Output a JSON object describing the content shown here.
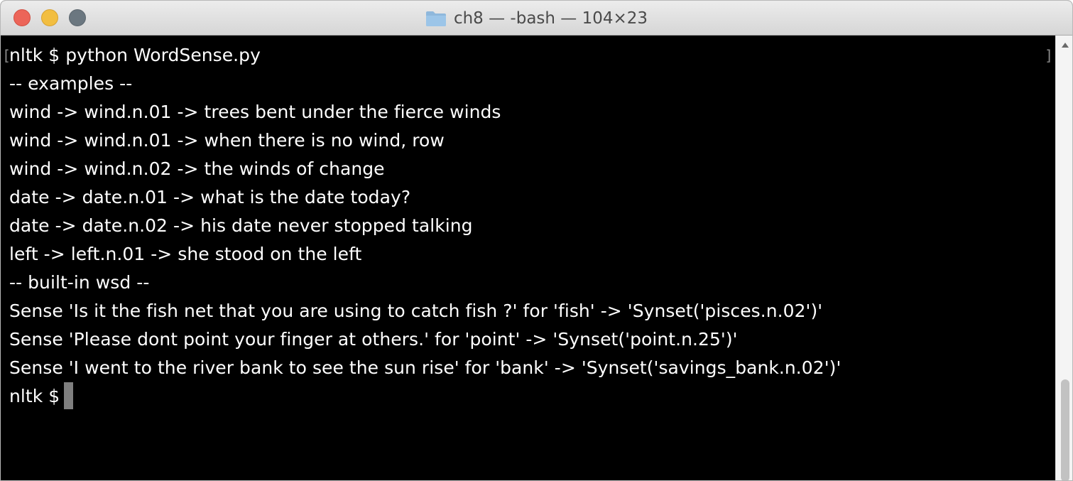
{
  "window": {
    "title": "ch8 — -bash — 104×23"
  },
  "icons": {
    "folder": "folder-icon"
  },
  "terminal": {
    "prompt_line": "nltk $ python WordSense.py",
    "lines": [
      "-- examples --",
      "wind -> wind.n.01 -> trees bent under the fierce winds",
      "wind -> wind.n.01 -> when there is no wind, row",
      "wind -> wind.n.02 -> the winds of change",
      "date -> date.n.01 -> what is the date today?",
      "date -> date.n.02 -> his date never stopped talking",
      "left -> left.n.01 -> she stood on the left",
      "-- built-in wsd --",
      "Sense 'Is it the fish net that you are using to catch fish ?' for 'fish' -> 'Synset('pisces.n.02')'",
      "Sense 'Please dont point your finger at others.' for 'point' -> 'Synset('point.n.25')'",
      "Sense 'I went to the river bank to see the sun rise' for 'bank' -> 'Synset('savings_bank.n.02')'"
    ],
    "final_prompt": "nltk $"
  },
  "colors": {
    "background": "#000000",
    "text": "#ffffff",
    "close": "#ec6559",
    "minimize": "#f2be41",
    "zoom": "#6b7780",
    "cursor": "#7f7f7f"
  }
}
